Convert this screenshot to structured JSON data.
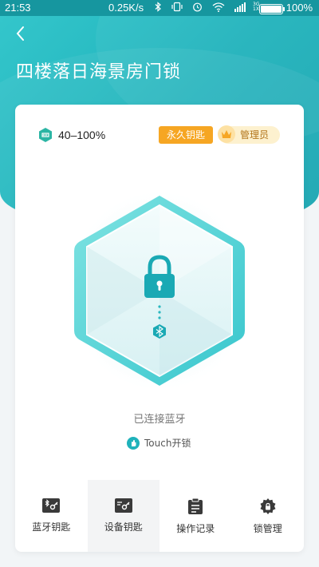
{
  "status_bar": {
    "time": "21:53",
    "network_speed": "0.25K/s",
    "signal_labels": [
      "3G",
      "1X"
    ],
    "battery_percent": "100%"
  },
  "header": {
    "title": "四楼落日海景房门锁"
  },
  "lock_card": {
    "battery_range": "40–100%",
    "key_type_badge": "永久钥匙",
    "role_badge": "管理员",
    "connection_status": "已连接蓝牙",
    "touch_unlock_label": "Touch开锁"
  },
  "bottom_nav": {
    "items": [
      {
        "label": "蓝牙钥匙",
        "icon": "bluetooth-key-icon"
      },
      {
        "label": "设备钥匙",
        "icon": "device-key-icon"
      },
      {
        "label": "操作记录",
        "icon": "clipboard-icon"
      },
      {
        "label": "锁管理",
        "icon": "gear-lock-icon"
      }
    ]
  },
  "colors": {
    "primary": "#1fb2bb",
    "key_badge": "#f6a623",
    "admin_badge_bg": "#fdf1cf"
  }
}
